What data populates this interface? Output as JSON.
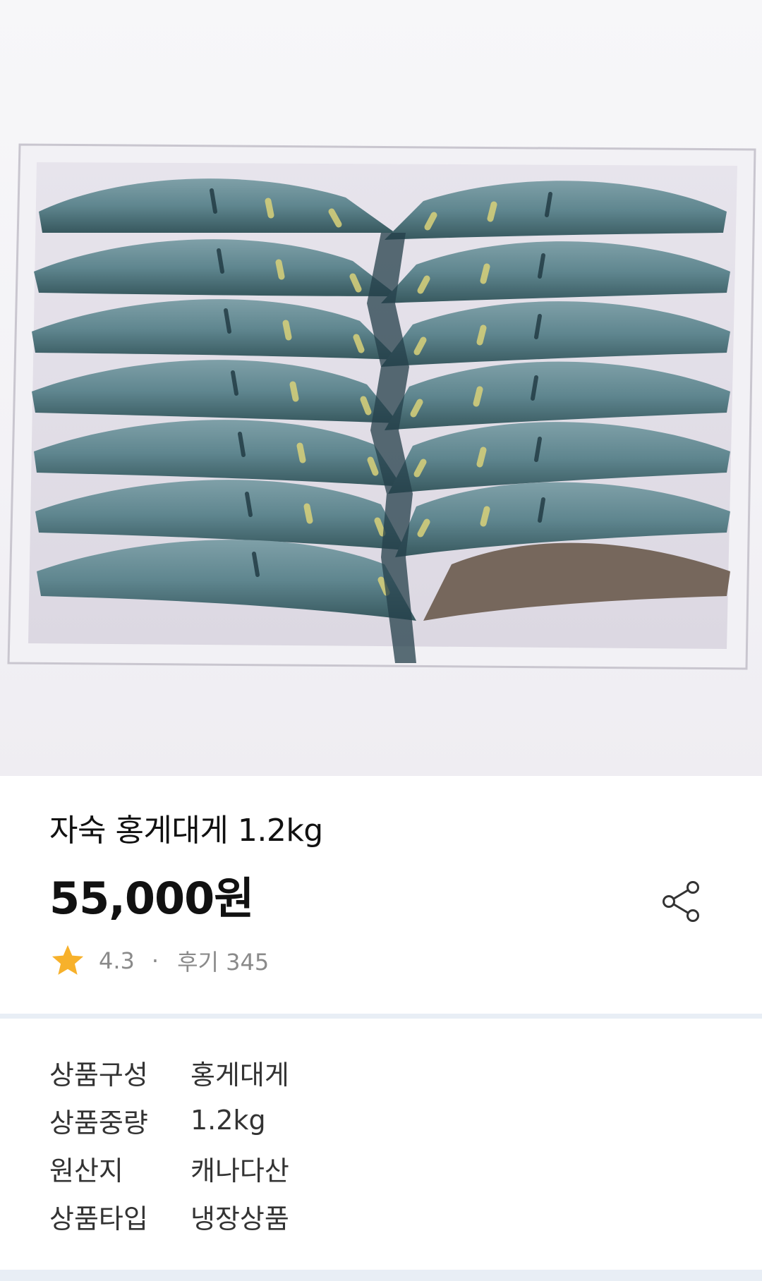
{
  "product": {
    "title": "자숙 홍게대게 1.2kg",
    "price": "55,000원",
    "rating": "4.3",
    "separator": "·",
    "reviews": "후기 345"
  },
  "icons": {
    "share": "share-icon",
    "star": "star-icon"
  },
  "colors": {
    "star": "#f7b12b",
    "divider": "#e8eef5",
    "muted_text": "#8a8a8a"
  },
  "specs": [
    {
      "label": "상품구성",
      "value": "홍게대게"
    },
    {
      "label": "상품중량",
      "value": "1.2kg"
    },
    {
      "label": "원산지",
      "value": "캐나다산"
    },
    {
      "label": "상품타입",
      "value": "냉장상품"
    }
  ]
}
